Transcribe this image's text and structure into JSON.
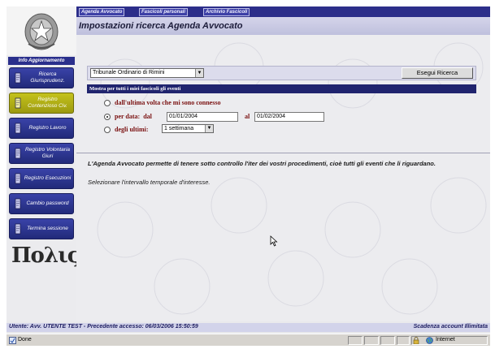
{
  "top_tabs": [
    "Agenda Avvocato",
    "Fascicoli personali",
    "Archivio Fascicoli"
  ],
  "page_title": "Impostazioni ricerca Agenda Avvocato",
  "sidebar": {
    "info_label": "Info Aggiornamento",
    "items": [
      {
        "label": "Ricerca Giurisprudenz.",
        "icon": "document-icon",
        "active": false
      },
      {
        "label": "Registro Contenzioso Civ.",
        "icon": "document-icon",
        "active": true
      },
      {
        "label": "Registro Lavoro",
        "icon": "document-icon",
        "active": false
      },
      {
        "label": "Registro Volontaria Giuri",
        "icon": "document-icon",
        "active": false
      },
      {
        "label": "Registro Esecuzioni",
        "icon": "document-icon",
        "active": false
      },
      {
        "label": "Cambio password",
        "icon": "document-icon",
        "active": false
      },
      {
        "label": "Termina sessione",
        "icon": "document-icon",
        "active": false
      }
    ],
    "logo_text": "Πολις"
  },
  "search": {
    "court_select": "Tribunale Ordinario di Rimini",
    "button_label": "Esegui Ricerca"
  },
  "events": {
    "header": "Mostra per tutti i miei fascicoli gli eventi",
    "option_last_login": "dall'ultima volta che mi sono connesso",
    "option_by_date": "per data:",
    "from_label": "dal",
    "from_value": "01/01/2004",
    "to_label": "al",
    "to_value": "01/02/2004",
    "option_last": "degli ultimi:",
    "period_value": "1 settimana",
    "selected": "by_date"
  },
  "description": {
    "line1": "L'Agenda Avvocato permette di tenere sotto controllo l'iter dei vostri procedimenti, cioè tutti gli eventi che li riguardano.",
    "line2": "Selezionare l'intervallo temporale d'interesse."
  },
  "footer": {
    "user_info": "Utente: Avv. UTENTE TEST - Precedente accesso: 06/03/2006 15:50:59",
    "account_expiry": "Scadenza account Illimitata"
  },
  "status_bar": {
    "status": "Done",
    "zone": "Internet"
  },
  "colors": {
    "nav_blue": "#2c2e8a",
    "active_yellow": "#c4c21c",
    "header_navy": "#20246e",
    "option_text": "#7a1010"
  }
}
